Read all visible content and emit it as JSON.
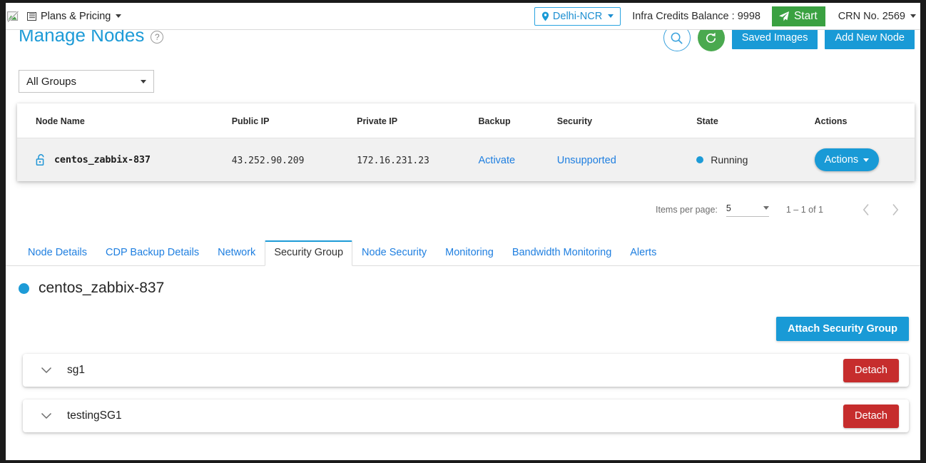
{
  "topbar": {
    "logo_icon": "broken-image-icon",
    "menu": {
      "label": "Plans & Pricing",
      "icon": "list-icon"
    },
    "region": {
      "label": "Delhi-NCR",
      "icon": "location-pin-icon"
    },
    "credits_label": "Infra Credits Balance : 9998",
    "start_button": {
      "label": "Start",
      "icon": "paper-plane-icon"
    },
    "crn_label": "CRN No. 2569"
  },
  "page": {
    "title": "Manage Nodes",
    "help_icon": "question-mark-icon",
    "search_icon": "search-icon",
    "refresh_icon": "refresh-icon",
    "saved_images_label": "Saved Images",
    "add_new_node_label": "Add New Node"
  },
  "group_filter": {
    "value": "All Groups"
  },
  "nodes_table": {
    "columns": [
      "Node Name",
      "Public IP",
      "Private IP",
      "Backup",
      "Security",
      "State",
      "Actions"
    ],
    "rows": [
      {
        "lock_icon": "unlocked-padlock-icon",
        "name": "centos_zabbix-837",
        "public_ip": "43.252.90.209",
        "private_ip": "172.16.231.23",
        "backup": "Activate",
        "security": "Unsupported",
        "state": "Running",
        "actions_label": "Actions"
      }
    ]
  },
  "paginator": {
    "items_per_page_label": "Items per page:",
    "items_per_page_value": "5",
    "range_label": "1 – 1 of 1",
    "prev_icon": "chevron-left-icon",
    "next_icon": "chevron-right-icon"
  },
  "tabs": [
    {
      "label": "Node Details",
      "active": false
    },
    {
      "label": "CDP Backup Details",
      "active": false
    },
    {
      "label": "Network",
      "active": false
    },
    {
      "label": "Security Group",
      "active": true
    },
    {
      "label": "Node Security",
      "active": false
    },
    {
      "label": "Monitoring",
      "active": false
    },
    {
      "label": "Bandwidth Monitoring",
      "active": false
    },
    {
      "label": "Alerts",
      "active": false
    }
  ],
  "security_group_panel": {
    "node_name": "centos_zabbix-837",
    "attach_button_label": "Attach Security Group",
    "groups": [
      {
        "name": "sg1",
        "detach_label": "Detach",
        "expand_icon": "chevron-down-icon"
      },
      {
        "name": "testingSG1",
        "detach_label": "Detach",
        "expand_icon": "chevron-down-icon"
      }
    ]
  },
  "colors": {
    "accent_blue": "#199ad6",
    "link_blue": "#1f7fe0",
    "green": "#3aa141",
    "danger_red": "#c62d2d"
  }
}
